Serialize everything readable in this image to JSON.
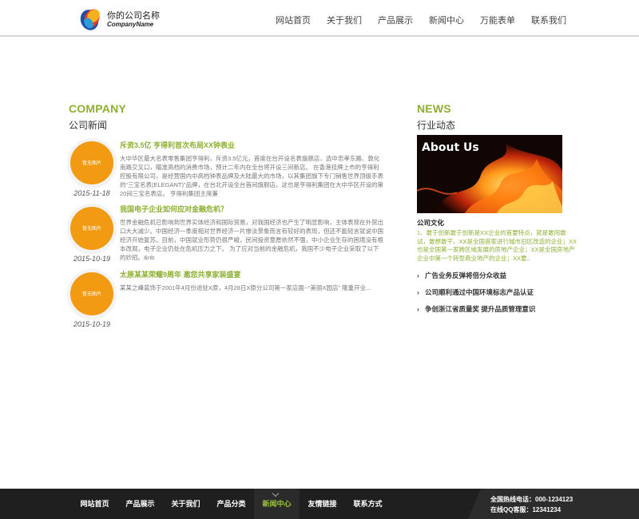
{
  "header": {
    "logo_cn": "你的公司名称",
    "logo_en": "CompanyName",
    "nav": [
      "网站首页",
      "关于我们",
      "产品展示",
      "新闻中心",
      "万能表单",
      "联系我们"
    ]
  },
  "company": {
    "title_en": "COMPANY",
    "title_cn": "公司新闻",
    "items": [
      {
        "date": "2015-11-18",
        "thumb": "暂无图片",
        "title": "斥资3.5亿 亨得利首次布局XX钟表业",
        "desc": "大中华区最大名表零售集团亨得利，斥资3.5亿元，首度在台开设名表旗舰店，选中忠孝东路、敦化南路交叉口，瞄准高档的消费市场，预计二年内在全台将开设三间新店。 在香港挂牌上市的亨得利控股有限公司，是经营国内中高档钟表品牌及大陆最大的市场，以其集团旗下专门销售世界顶级手表的“三宝名表(ELEGANT)”品牌，在台北开设全台首间旗舰店。这也是亨得利集团在大中华区开设的第20间三宝名表店。 亨得利集团主席兼"
      },
      {
        "date": "2015-10-19",
        "thumb": "暂无图片",
        "title": "我国电子企业如何应对金融危机？",
        "desc": "世界金融危机已影响到世界实体经济和国际贸易，对我国经济也产生了明显影响，主体表现在外贸出口大大减少。中国经济一季度相对世界经济一片惨淡景象而言有较好的表现，但还不能轻言就说中国经济开始复苏。目前，中国就业形势仍很严峻，民间投资意愿依然不强，中小企业生存的困境没有根本改观，电子企业仍处在危机压力之下。 为了应对当前的金融危机，我国不少电子企业采取了以下的妙招。&nb"
      },
      {
        "date": "2015-10-19",
        "thumb": "暂无图片",
        "title": "太原某某荣耀9周年 邀您共享家装盛宴",
        "desc": "某某之峰装饰于2001年4月份进驻X原，4月28日X原分公司第一家店面--“美丽X园店” 隆重开业..."
      }
    ]
  },
  "news": {
    "title_en": "NEWS",
    "title_cn": "行业动态",
    "image_caption": "About Us",
    "culture_head": "公司文化",
    "culture_text": "1、敢于创新敢于创新是XX企业的首要特点，就是敢闯敢试，敢想敢干。XX是全国首家进行城市旧区改造的企业；XX也是全国第一家跨区域发展的房地产企业；XX是全国房地产企业中第一个转型商业地产的企业；XX要..",
    "items": [
      "广告业务反弹将倍分众收益",
      "公司顺利通过中国环境标志产品认证",
      "争创浙江省质量奖 提升品质管理意识"
    ]
  },
  "footer": {
    "nav": [
      "网站首页",
      "产品展示",
      "关于我们",
      "产品分类",
      "新闻中心",
      "友情链接",
      "联系方式"
    ],
    "active_index": 4,
    "phone": "全国热线电话：000-1234123",
    "qq": "在线QQ客服：12341234"
  },
  "colors": {
    "accent_green": "#8db032",
    "orange": "#f29a12",
    "footer_bg": "#1f1f1f"
  }
}
